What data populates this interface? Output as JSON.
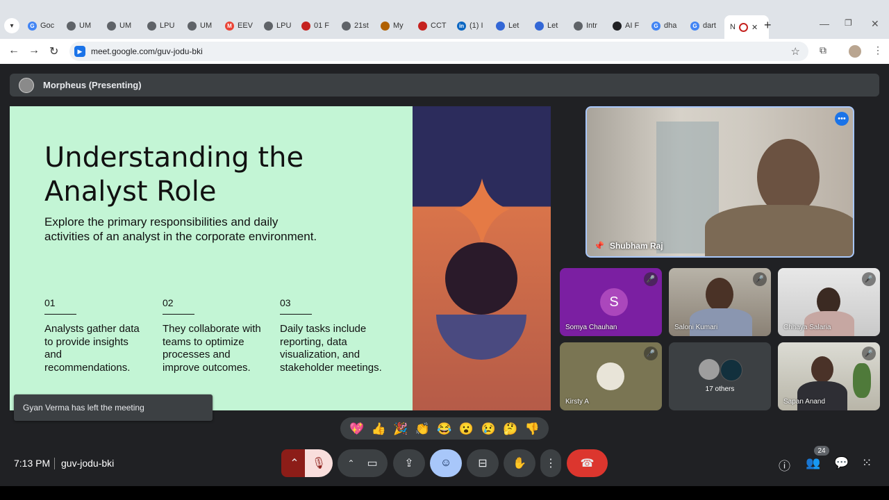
{
  "browser": {
    "tabs": [
      {
        "label": "Goc",
        "fav": "G",
        "color": "#4285f4"
      },
      {
        "label": "UM",
        "fav": "",
        "color": "#5f6368"
      },
      {
        "label": "UM",
        "fav": "",
        "color": "#5f6368"
      },
      {
        "label": "LPU",
        "fav": "",
        "color": "#5f6368"
      },
      {
        "label": "UM",
        "fav": "",
        "color": "#5f6368"
      },
      {
        "label": "EEV",
        "fav": "M",
        "color": "#ea4335"
      },
      {
        "label": "LPU",
        "fav": "",
        "color": "#5f6368"
      },
      {
        "label": "01 F",
        "fav": "",
        "color": "#c5221f"
      },
      {
        "label": "21st",
        "fav": "",
        "color": "#5f6368"
      },
      {
        "label": "My",
        "fav": "",
        "color": "#b06000"
      },
      {
        "label": "CCT",
        "fav": "",
        "color": "#c5221f"
      },
      {
        "label": "(1) I",
        "fav": "in",
        "color": "#0a66c2"
      },
      {
        "label": "Let",
        "fav": "",
        "color": "#3367d6"
      },
      {
        "label": "Let",
        "fav": "",
        "color": "#3367d6"
      },
      {
        "label": "Intr",
        "fav": "",
        "color": "#5f6368"
      },
      {
        "label": "AI F",
        "fav": "",
        "color": "#202124"
      },
      {
        "label": "dha",
        "fav": "G",
        "color": "#4285f4"
      },
      {
        "label": "dart",
        "fav": "G",
        "color": "#4285f4"
      }
    ],
    "active_tab_label": "N",
    "url": "meet.google.com/guv-jodu-bki"
  },
  "presenter_bar": {
    "text": "Morpheus (Presenting)"
  },
  "slide": {
    "title": "Understanding the Analyst Role",
    "subtitle": "Explore the primary responsibilities and daily activities of an analyst in the corporate environment.",
    "columns": [
      {
        "num": "01",
        "text": "Analysts gather data to provide insights and recommendations."
      },
      {
        "num": "02",
        "text": "They collaborate with teams to optimize processes and improve outcomes."
      },
      {
        "num": "03",
        "text": "Daily tasks include reporting, data visualization, and stakeholder meetings."
      }
    ]
  },
  "toast": "Gyan Verma has left the meeting",
  "participants": {
    "pinned": "Shubham Raj",
    "tiles": [
      "Somya Chauhan",
      "Saloni Kumari",
      "Chhaya Salaria",
      "Kirsty A",
      "17 others",
      "Sapan Anand"
    ],
    "somya_initial": "S"
  },
  "reactions": [
    "💖",
    "👍",
    "🎉",
    "👏",
    "😂",
    "😮",
    "😢",
    "🤔",
    "👎"
  ],
  "bottom": {
    "time": "7:13 PM",
    "meeting_code": "guv-jodu-bki",
    "people_count": "24"
  },
  "colors": {
    "hangup": "#dc362e",
    "muted_mic_bg": "#f9dedc",
    "mic_red": "#8c1d18",
    "emoji_active": "#a8c7fa"
  }
}
